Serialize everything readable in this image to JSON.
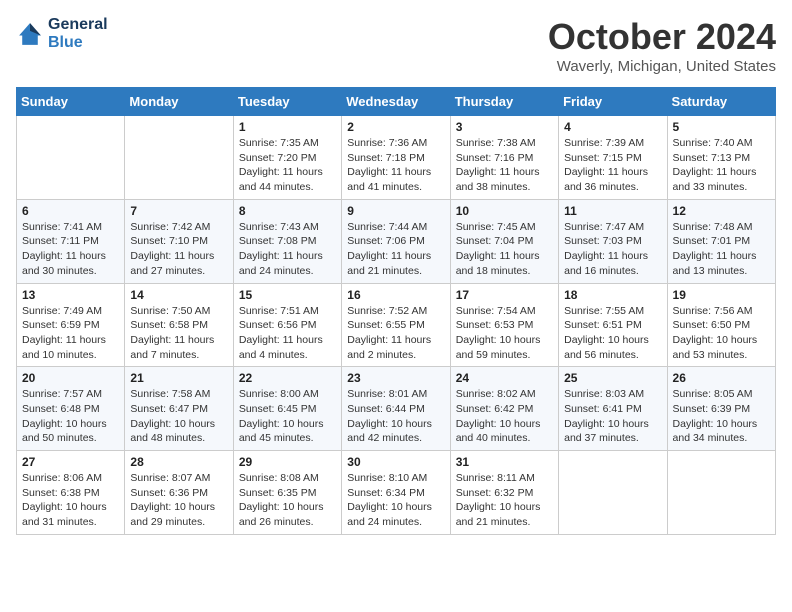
{
  "header": {
    "logo_line1": "General",
    "logo_line2": "Blue",
    "month_title": "October 2024",
    "location": "Waverly, Michigan, United States"
  },
  "weekdays": [
    "Sunday",
    "Monday",
    "Tuesday",
    "Wednesday",
    "Thursday",
    "Friday",
    "Saturday"
  ],
  "weeks": [
    [
      null,
      null,
      {
        "day": "1",
        "sunrise": "Sunrise: 7:35 AM",
        "sunset": "Sunset: 7:20 PM",
        "daylight": "Daylight: 11 hours and 44 minutes."
      },
      {
        "day": "2",
        "sunrise": "Sunrise: 7:36 AM",
        "sunset": "Sunset: 7:18 PM",
        "daylight": "Daylight: 11 hours and 41 minutes."
      },
      {
        "day": "3",
        "sunrise": "Sunrise: 7:38 AM",
        "sunset": "Sunset: 7:16 PM",
        "daylight": "Daylight: 11 hours and 38 minutes."
      },
      {
        "day": "4",
        "sunrise": "Sunrise: 7:39 AM",
        "sunset": "Sunset: 7:15 PM",
        "daylight": "Daylight: 11 hours and 36 minutes."
      },
      {
        "day": "5",
        "sunrise": "Sunrise: 7:40 AM",
        "sunset": "Sunset: 7:13 PM",
        "daylight": "Daylight: 11 hours and 33 minutes."
      }
    ],
    [
      {
        "day": "6",
        "sunrise": "Sunrise: 7:41 AM",
        "sunset": "Sunset: 7:11 PM",
        "daylight": "Daylight: 11 hours and 30 minutes."
      },
      {
        "day": "7",
        "sunrise": "Sunrise: 7:42 AM",
        "sunset": "Sunset: 7:10 PM",
        "daylight": "Daylight: 11 hours and 27 minutes."
      },
      {
        "day": "8",
        "sunrise": "Sunrise: 7:43 AM",
        "sunset": "Sunset: 7:08 PM",
        "daylight": "Daylight: 11 hours and 24 minutes."
      },
      {
        "day": "9",
        "sunrise": "Sunrise: 7:44 AM",
        "sunset": "Sunset: 7:06 PM",
        "daylight": "Daylight: 11 hours and 21 minutes."
      },
      {
        "day": "10",
        "sunrise": "Sunrise: 7:45 AM",
        "sunset": "Sunset: 7:04 PM",
        "daylight": "Daylight: 11 hours and 18 minutes."
      },
      {
        "day": "11",
        "sunrise": "Sunrise: 7:47 AM",
        "sunset": "Sunset: 7:03 PM",
        "daylight": "Daylight: 11 hours and 16 minutes."
      },
      {
        "day": "12",
        "sunrise": "Sunrise: 7:48 AM",
        "sunset": "Sunset: 7:01 PM",
        "daylight": "Daylight: 11 hours and 13 minutes."
      }
    ],
    [
      {
        "day": "13",
        "sunrise": "Sunrise: 7:49 AM",
        "sunset": "Sunset: 6:59 PM",
        "daylight": "Daylight: 11 hours and 10 minutes."
      },
      {
        "day": "14",
        "sunrise": "Sunrise: 7:50 AM",
        "sunset": "Sunset: 6:58 PM",
        "daylight": "Daylight: 11 hours and 7 minutes."
      },
      {
        "day": "15",
        "sunrise": "Sunrise: 7:51 AM",
        "sunset": "Sunset: 6:56 PM",
        "daylight": "Daylight: 11 hours and 4 minutes."
      },
      {
        "day": "16",
        "sunrise": "Sunrise: 7:52 AM",
        "sunset": "Sunset: 6:55 PM",
        "daylight": "Daylight: 11 hours and 2 minutes."
      },
      {
        "day": "17",
        "sunrise": "Sunrise: 7:54 AM",
        "sunset": "Sunset: 6:53 PM",
        "daylight": "Daylight: 10 hours and 59 minutes."
      },
      {
        "day": "18",
        "sunrise": "Sunrise: 7:55 AM",
        "sunset": "Sunset: 6:51 PM",
        "daylight": "Daylight: 10 hours and 56 minutes."
      },
      {
        "day": "19",
        "sunrise": "Sunrise: 7:56 AM",
        "sunset": "Sunset: 6:50 PM",
        "daylight": "Daylight: 10 hours and 53 minutes."
      }
    ],
    [
      {
        "day": "20",
        "sunrise": "Sunrise: 7:57 AM",
        "sunset": "Sunset: 6:48 PM",
        "daylight": "Daylight: 10 hours and 50 minutes."
      },
      {
        "day": "21",
        "sunrise": "Sunrise: 7:58 AM",
        "sunset": "Sunset: 6:47 PM",
        "daylight": "Daylight: 10 hours and 48 minutes."
      },
      {
        "day": "22",
        "sunrise": "Sunrise: 8:00 AM",
        "sunset": "Sunset: 6:45 PM",
        "daylight": "Daylight: 10 hours and 45 minutes."
      },
      {
        "day": "23",
        "sunrise": "Sunrise: 8:01 AM",
        "sunset": "Sunset: 6:44 PM",
        "daylight": "Daylight: 10 hours and 42 minutes."
      },
      {
        "day": "24",
        "sunrise": "Sunrise: 8:02 AM",
        "sunset": "Sunset: 6:42 PM",
        "daylight": "Daylight: 10 hours and 40 minutes."
      },
      {
        "day": "25",
        "sunrise": "Sunrise: 8:03 AM",
        "sunset": "Sunset: 6:41 PM",
        "daylight": "Daylight: 10 hours and 37 minutes."
      },
      {
        "day": "26",
        "sunrise": "Sunrise: 8:05 AM",
        "sunset": "Sunset: 6:39 PM",
        "daylight": "Daylight: 10 hours and 34 minutes."
      }
    ],
    [
      {
        "day": "27",
        "sunrise": "Sunrise: 8:06 AM",
        "sunset": "Sunset: 6:38 PM",
        "daylight": "Daylight: 10 hours and 31 minutes."
      },
      {
        "day": "28",
        "sunrise": "Sunrise: 8:07 AM",
        "sunset": "Sunset: 6:36 PM",
        "daylight": "Daylight: 10 hours and 29 minutes."
      },
      {
        "day": "29",
        "sunrise": "Sunrise: 8:08 AM",
        "sunset": "Sunset: 6:35 PM",
        "daylight": "Daylight: 10 hours and 26 minutes."
      },
      {
        "day": "30",
        "sunrise": "Sunrise: 8:10 AM",
        "sunset": "Sunset: 6:34 PM",
        "daylight": "Daylight: 10 hours and 24 minutes."
      },
      {
        "day": "31",
        "sunrise": "Sunrise: 8:11 AM",
        "sunset": "Sunset: 6:32 PM",
        "daylight": "Daylight: 10 hours and 21 minutes."
      },
      null,
      null
    ]
  ]
}
